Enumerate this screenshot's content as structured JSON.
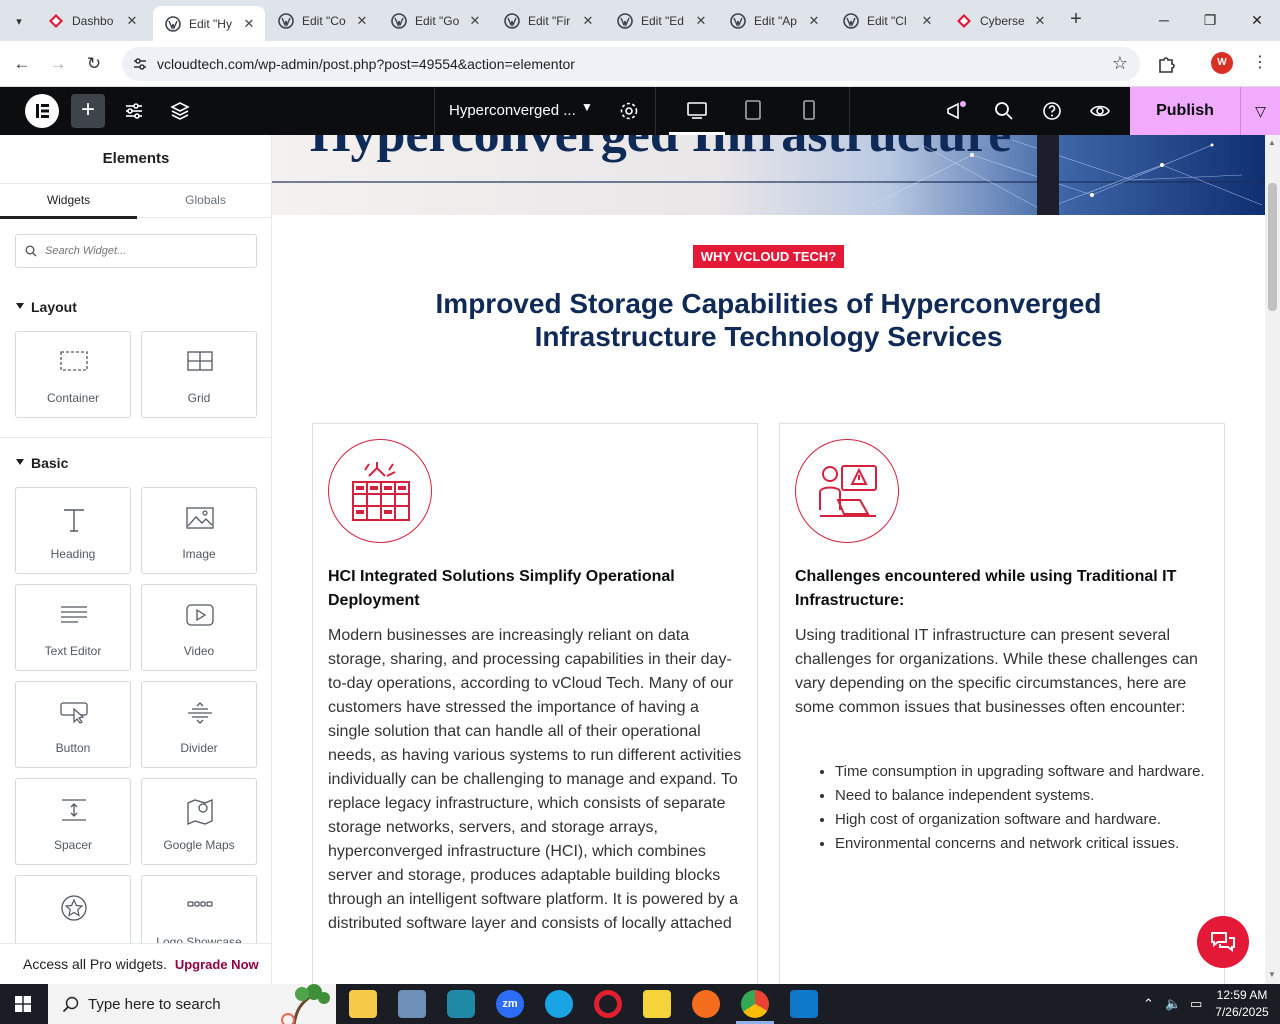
{
  "browser": {
    "tabs": [
      {
        "title": "Dashbo",
        "favicon": "wp-red-icon",
        "active": false
      },
      {
        "title": "Edit \"Hy",
        "favicon": "wordpress-icon",
        "active": true
      },
      {
        "title": "Edit \"Co",
        "favicon": "wordpress-icon",
        "active": false
      },
      {
        "title": "Edit \"Go",
        "favicon": "wordpress-icon",
        "active": false
      },
      {
        "title": "Edit \"Fir",
        "favicon": "wordpress-icon",
        "active": false
      },
      {
        "title": "Edit \"Ed",
        "favicon": "wordpress-icon",
        "active": false
      },
      {
        "title": "Edit \"Ap",
        "favicon": "wordpress-icon",
        "active": false
      },
      {
        "title": "Edit \"Cl",
        "favicon": "wordpress-icon",
        "active": false
      },
      {
        "title": "Cyberse",
        "favicon": "wp-red-icon",
        "active": false
      }
    ],
    "url": "vcloudtech.com/wp-admin/post.php?post=49554&action=elementor",
    "profile_initial": "W"
  },
  "elementor": {
    "document_name": "Hyperconverged ...",
    "publish_label": "Publish"
  },
  "panel": {
    "title": "Elements",
    "tabs": [
      "Widgets",
      "Globals"
    ],
    "search_placeholder": "Search Widget...",
    "categories": {
      "layout": "Layout",
      "basic": "Basic"
    },
    "layout_widgets": [
      "Container",
      "Grid"
    ],
    "basic_widgets": [
      "Heading",
      "Image",
      "Text Editor",
      "Video",
      "Button",
      "Divider",
      "Spacer",
      "Google Maps",
      "",
      "Logo Showcase"
    ],
    "pro_text": "Access all Pro widgets.",
    "pro_link": "Upgrade Now"
  },
  "page": {
    "hero_title": "Hyperconverged Infrastructure",
    "badge": "WHY VCLOUD TECH?",
    "headline": "Improved Storage Capabilities of Hyperconverged Infrastructure Technology Services",
    "card1": {
      "title": "HCI Integrated Solutions Simplify Operational Deployment",
      "body": "Modern businesses are increasingly reliant on data storage, sharing, and processing capabilities in their day-to-day operations, according to vCloud Tech. Many of our customers have stressed the importance of having a single solution that can handle all of their operational needs, as having various systems to run different activities individually can be challenging to manage and expand. To replace legacy infrastructure, which consists of separate storage networks, servers, and storage arrays, hyperconverged infrastructure (HCI), which combines server and storage, produces adaptable building blocks through an intelligent software platform. It is powered by a distributed software layer and consists of locally attached"
    },
    "card2": {
      "title": "Challenges encountered while using Traditional IT Infrastructure:",
      "body": "Using traditional IT infrastructure can present several challenges for organizations. While these challenges can vary depending on the specific circumstances, here are some common issues that businesses often encounter:",
      "bullets": [
        "Time consumption in upgrading software and hardware.",
        "Need to balance independent systems.",
        "High cost of organization software and hardware.",
        "Environmental concerns and network critical issues."
      ]
    }
  },
  "taskbar": {
    "search_placeholder": "Type here to search",
    "time": "12:59 AM",
    "date": "7/26/2025"
  },
  "colors": {
    "accent_red": "#e31937",
    "navy": "#0f2a56",
    "publish_pink": "#f0abfc",
    "elementor_bar": "#0c0d0e"
  }
}
